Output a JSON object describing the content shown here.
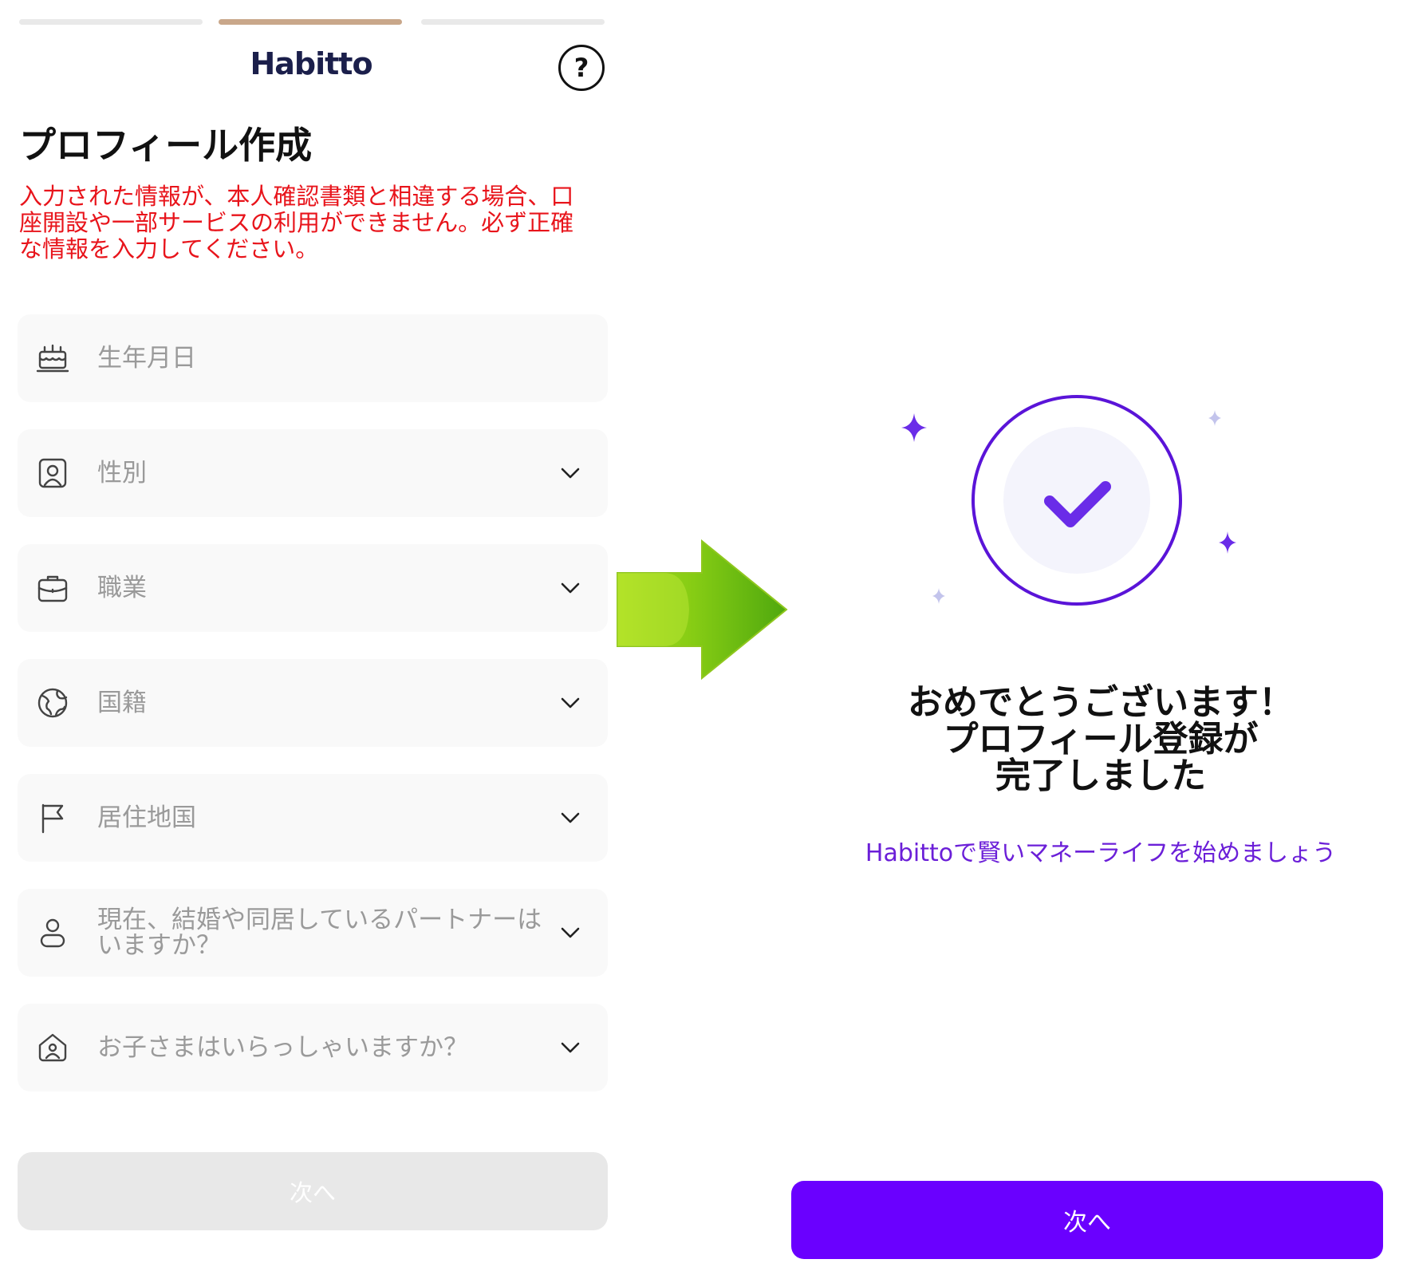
{
  "left_screen": {
    "progress": {
      "total_steps": 3,
      "current_step": 2
    },
    "logo": "Habitto",
    "help_icon": "question-circle-icon",
    "title": "プロフィール作成",
    "warning": "入力された情報が、本人確認書類と相違する場合、口座開設や一部サービスの利用ができません。必ず正確な情報を入力してください。",
    "fields": [
      {
        "icon": "cake-icon",
        "placeholder": "生年月日",
        "dropdown": false
      },
      {
        "icon": "person-badge-icon",
        "placeholder": "性別",
        "dropdown": true
      },
      {
        "icon": "briefcase-icon",
        "placeholder": "職業",
        "dropdown": true
      },
      {
        "icon": "globe-icon",
        "placeholder": "国籍",
        "dropdown": true
      },
      {
        "icon": "flag-icon",
        "placeholder": "居住地国",
        "dropdown": true
      },
      {
        "icon": "user-icon",
        "placeholder": "現在、結婚や同居しているパートナーはいますか？",
        "dropdown": true
      },
      {
        "icon": "home-user-icon",
        "placeholder": "お子さまはいらっしゃいますか？",
        "dropdown": true
      }
    ],
    "next_button": "次へ",
    "colors": {
      "progress_active": "#c9a78a",
      "warning": "#e8141b",
      "logo": "#1b1f4b"
    }
  },
  "transition_arrow": {
    "icon": "green-right-arrow-icon"
  },
  "right_screen": {
    "success_icon": "check-circle-icon",
    "congrats_lines": [
      "おめでとうございます！",
      "プロフィール登録が",
      "完了しました"
    ],
    "subtitle": "Habittoで賢いマネーライフを始めましょう",
    "next_button": "次へ",
    "colors": {
      "primary": "#6a00ff",
      "accent": "#6b1fd8"
    }
  }
}
